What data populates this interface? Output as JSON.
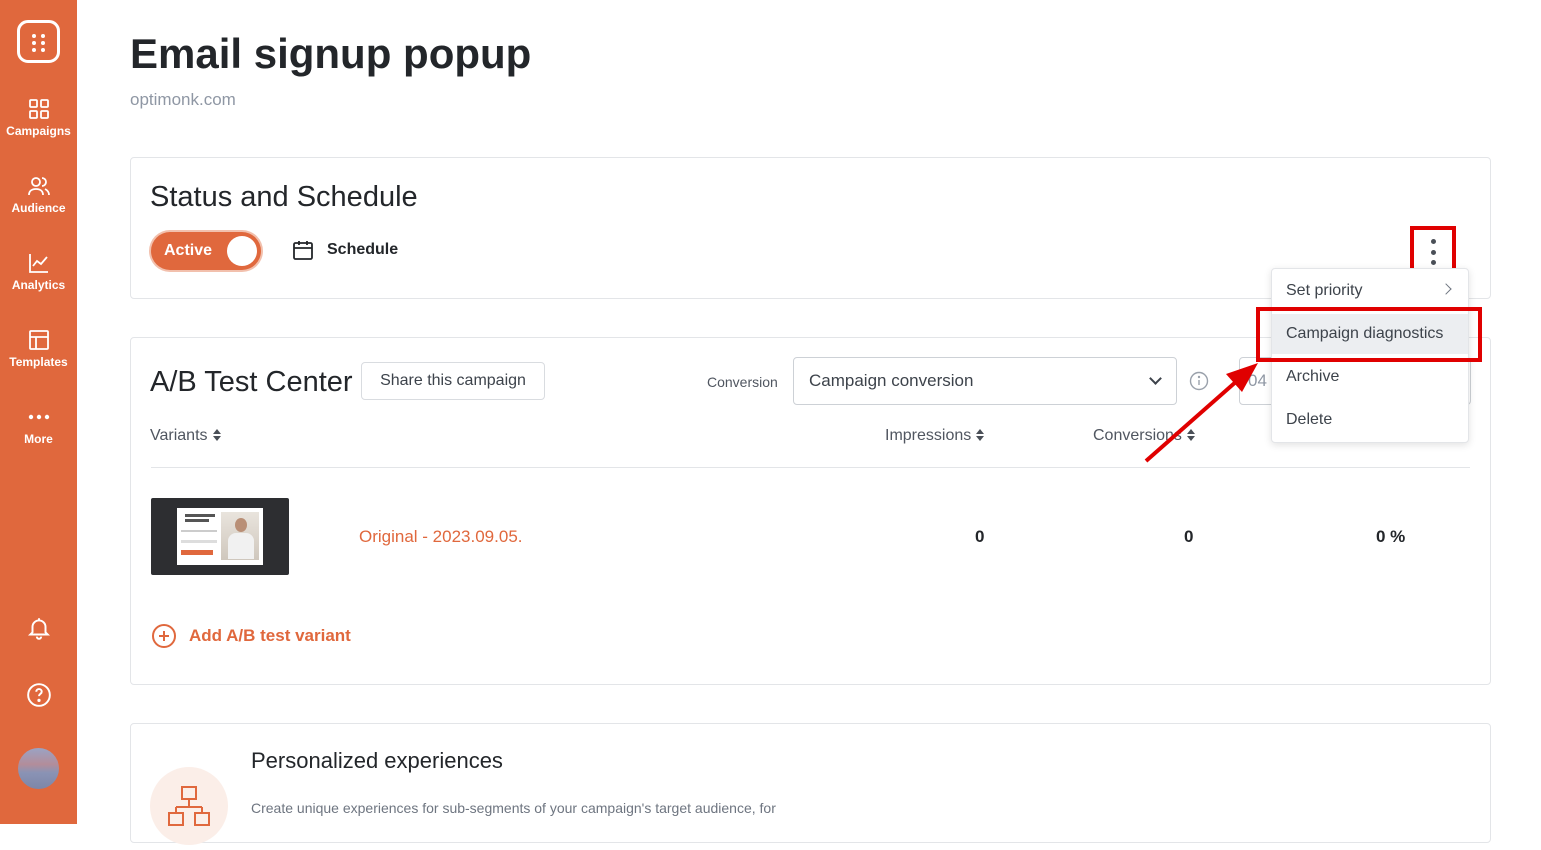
{
  "sidebar": {
    "items": [
      {
        "label": "Campaigns",
        "icon": "grid-icon"
      },
      {
        "label": "Audience",
        "icon": "users-icon"
      },
      {
        "label": "Analytics",
        "icon": "chart-icon"
      },
      {
        "label": "Templates",
        "icon": "layout-icon"
      },
      {
        "label": "More",
        "icon": "dots-icon"
      }
    ],
    "bottom_icons": [
      "bell-icon",
      "help-icon",
      "avatar"
    ]
  },
  "page": {
    "title": "Email signup popup",
    "domain": "optimonk.com"
  },
  "status": {
    "heading": "Status and Schedule",
    "toggle_label": "Active",
    "schedule_label": "Schedule"
  },
  "menu": {
    "items": [
      "Set priority",
      "Campaign diagnostics",
      "Archive",
      "Delete"
    ]
  },
  "ab": {
    "heading": "A/B Test Center",
    "share_label": "Share this campaign",
    "conversion_label": "Conversion",
    "conversion_value": "Campaign conversion",
    "date_value": "04",
    "columns": [
      "Variants",
      "Impressions",
      "Conversions"
    ],
    "rows": [
      {
        "name": "Original - 2023.09.05.",
        "impressions": "0",
        "conversions": "0",
        "rate": "0 %"
      }
    ],
    "add_variant_label": "Add A/B test variant"
  },
  "personalized": {
    "title": "Personalized experiences",
    "description": "Create unique experiences for sub-segments of your campaign's target audience, for"
  },
  "colors": {
    "brand": "#e0683d",
    "highlight": "#e00000"
  }
}
